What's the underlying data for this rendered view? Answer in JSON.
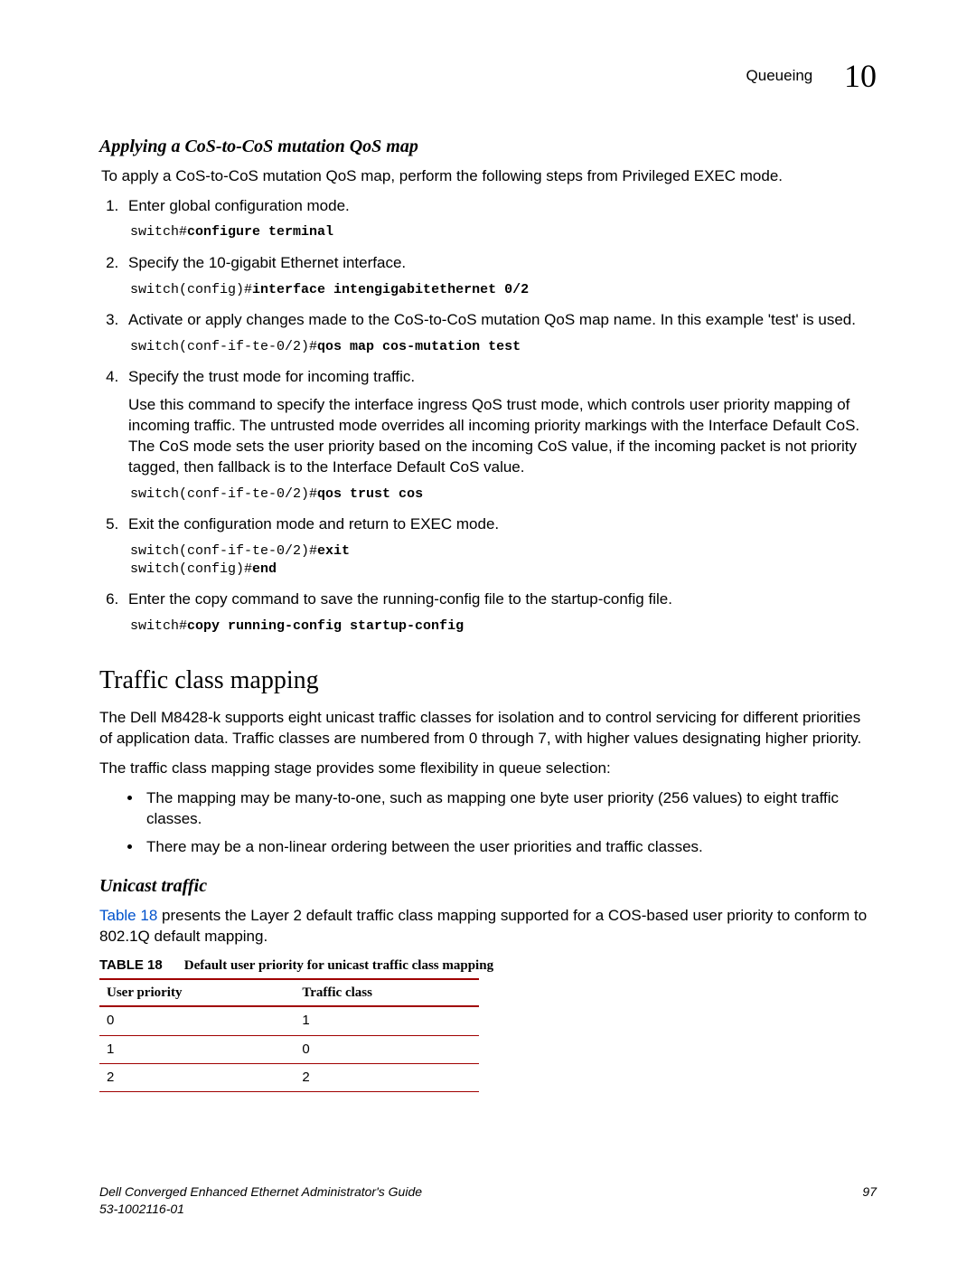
{
  "header": {
    "section": "Queueing",
    "chapter": "10"
  },
  "sub1": {
    "title": "Applying a CoS-to-CoS mutation QoS map",
    "intro": "To apply a CoS-to-CoS mutation QoS map, perform the following steps from Privileged EXEC mode.",
    "steps": [
      {
        "text": "Enter global configuration mode.",
        "code_prompt": "switch#",
        "code_cmd": "configure terminal"
      },
      {
        "text": "Specify the 10-gigabit Ethernet interface.",
        "code_prompt": "switch(config)#",
        "code_cmd": "interface intengigabitethernet 0/2"
      },
      {
        "text": "Activate or apply changes made to the CoS-to-CoS mutation QoS map name. In this example 'test' is used.",
        "code_prompt": "switch(conf-if-te-0/2)#",
        "code_cmd": "qos map cos-mutation test"
      },
      {
        "text": "Specify the trust mode for incoming traffic.",
        "extra": "Use this command to specify the interface ingress QoS trust mode, which controls user priority mapping of incoming traffic. The untrusted mode overrides all incoming priority markings with the Interface Default CoS. The CoS mode sets the user priority based on the incoming CoS value, if the incoming packet is not priority tagged, then fallback is to the Interface Default CoS value.",
        "code_prompt": "switch(conf-if-te-0/2)#",
        "code_cmd": "qos trust cos"
      },
      {
        "text": "Exit the configuration mode and return to EXEC mode.",
        "code_prompt": "switch(conf-if-te-0/2)#",
        "code_cmd": "exit",
        "code2_prompt": "switch(config)#",
        "code2_cmd": "end"
      },
      {
        "text": "Enter the copy command to save the running-config file to the startup-config file.",
        "code_prompt": "switch#",
        "code_cmd": "copy running-config startup-config"
      }
    ]
  },
  "section2": {
    "title": "Traffic class mapping",
    "p1": "The Dell M8428-k supports eight unicast traffic classes for isolation and to control servicing for different priorities of application data. Traffic classes are numbered from 0 through 7, with higher values designating higher priority.",
    "p2": "The traffic class mapping stage provides some flexibility in queue selection:",
    "bullets": [
      "The mapping may be many-to-one, such as mapping one byte user priority (256 values) to eight traffic classes.",
      "There may be a non-linear ordering between the user priorities and traffic classes."
    ]
  },
  "sub2": {
    "title": "Unicast traffic",
    "link": "Table 18",
    "rest": " presents the Layer 2 default traffic class mapping supported for a COS-based user priority to conform to 802.1Q default mapping."
  },
  "table": {
    "num": "TABLE 18",
    "caption": "Default user priority for unicast traffic class mapping",
    "h1": "User priority",
    "h2": "Traffic class",
    "rows": [
      {
        "c1": "0",
        "c2": "1"
      },
      {
        "c1": "1",
        "c2": "0"
      },
      {
        "c1": "2",
        "c2": "2"
      }
    ]
  },
  "footer": {
    "title": "Dell Converged Enhanced Ethernet Administrator's Guide",
    "page": "97",
    "docid": "53-1002116-01"
  }
}
